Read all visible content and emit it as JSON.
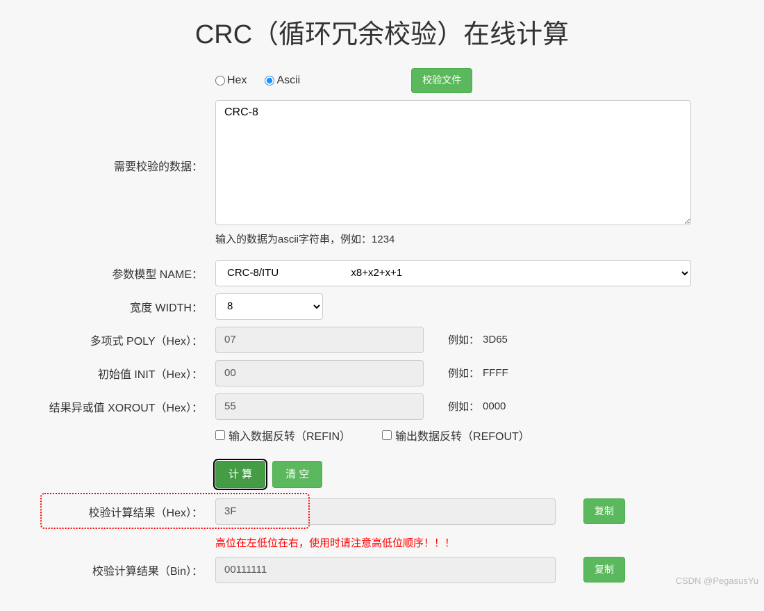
{
  "title": "CRC（循环冗余校验）在线计算",
  "radio": {
    "hex": "Hex",
    "ascii": "Ascii",
    "selected": "ascii"
  },
  "verify_file_btn": "校验文件",
  "data_label": "需要校验的数据：",
  "data_value": "CRC-8",
  "data_hint": "输入的数据为ascii字符串，例如：1234",
  "name": {
    "label": "参数模型 NAME：",
    "value_name": "CRC-8/ITU",
    "value_poly": "x8+x2+x+1"
  },
  "width": {
    "label": "宽度 WIDTH：",
    "value": "8"
  },
  "poly": {
    "label": "多项式 POLY（Hex）：",
    "value": "07",
    "example_label": "例如：",
    "example": "3D65"
  },
  "init": {
    "label": "初始值 INIT（Hex）：",
    "value": "00",
    "example_label": "例如：",
    "example": "FFFF"
  },
  "xorout": {
    "label": "结果异或值 XOROUT（Hex）：",
    "value": "55",
    "example_label": "例如：",
    "example": "0000"
  },
  "refin": {
    "label": "输入数据反转（REFIN）",
    "checked": false
  },
  "refout": {
    "label": "输出数据反转（REFOUT）",
    "checked": false
  },
  "calc_btn": "计 算",
  "clear_btn": "清 空",
  "result_hex": {
    "label": "校验计算结果（Hex）：",
    "value": "3F",
    "copy": "复制",
    "warning": "高位在左低位在右，使用时请注意高低位顺序！！！"
  },
  "result_bin": {
    "label": "校验计算结果（Bin）：",
    "value": "00111111",
    "copy": "复制"
  },
  "watermark": "CSDN @PegasusYu"
}
